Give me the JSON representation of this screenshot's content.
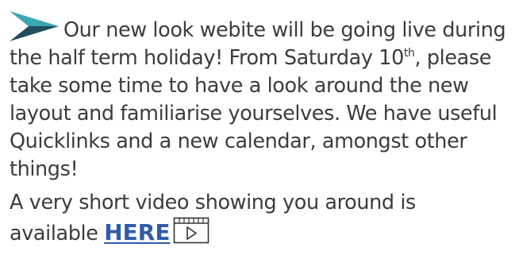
{
  "notice": {
    "icon": "arrow-bullet-icon",
    "para1_part1": "Our new look webite will be going live during the half term holiday! From Saturday 10",
    "para1_sup": "th",
    "para1_part2": ", please take some time to have a look around the new layout and familiarise yourselves. We have useful Quicklinks and a new calendar, amongst other things!",
    "para2_text": "A very short video showing you around is available ",
    "link_label": "HERE",
    "video_icon": "video-play-icon"
  },
  "colors": {
    "text": "#3c3c3c",
    "link": "#2f5ba8",
    "arrow_dark": "#1f4e5c",
    "arrow_light": "#3aa7b3"
  }
}
